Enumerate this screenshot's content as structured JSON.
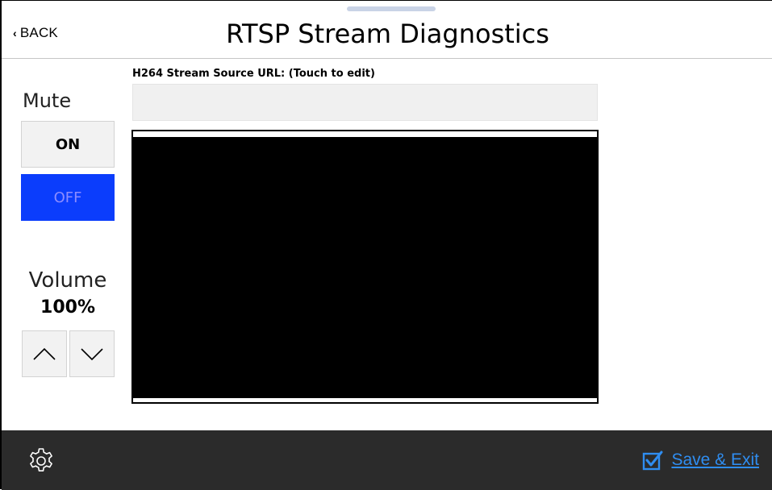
{
  "header": {
    "back_label": "BACK",
    "title": "RTSP Stream Diagnostics"
  },
  "mute": {
    "label": "Mute",
    "on_label": "ON",
    "off_label": "OFF",
    "selected": "OFF"
  },
  "volume": {
    "label": "Volume",
    "value": "100%"
  },
  "stream": {
    "url_label": "H264 Stream Source URL: (Touch to edit)",
    "url_value": "",
    "url_placeholder": ""
  },
  "footer": {
    "save_exit_label": "Save & Exit"
  },
  "icons": {
    "back": "chevron-left-icon",
    "volume_up": "chevron-up-icon",
    "volume_down": "chevron-down-icon",
    "settings": "gear-icon",
    "save": "checkbox-checked-icon"
  },
  "colors": {
    "off_button_bg": "#0b3dfc",
    "off_button_text": "#8c8cff",
    "footer_bg": "#2b2b2b",
    "accent_link": "#2f8df0",
    "video_bg": "#000000"
  }
}
